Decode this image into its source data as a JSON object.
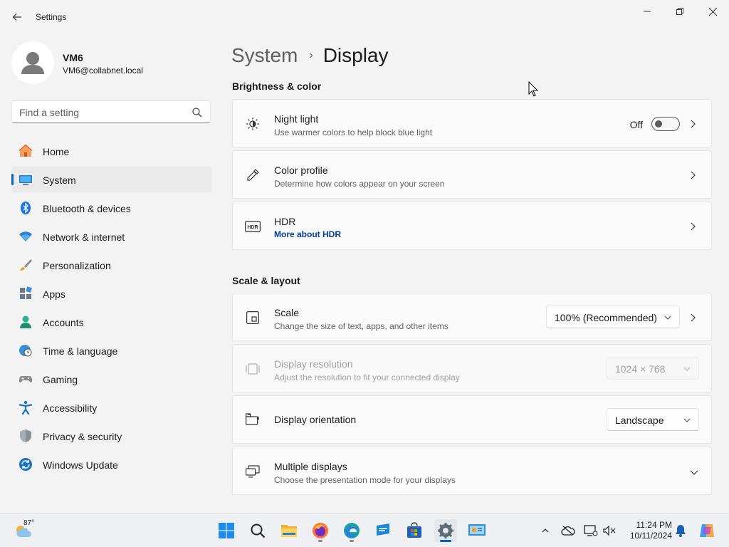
{
  "window": {
    "title": "Settings"
  },
  "profile": {
    "name": "VM6",
    "email": "VM6@collabnet.local"
  },
  "search": {
    "placeholder": "Find a setting"
  },
  "sidebar": {
    "items": [
      {
        "label": "Home",
        "icon": "home-icon"
      },
      {
        "label": "System",
        "icon": "system-icon",
        "active": true
      },
      {
        "label": "Bluetooth & devices",
        "icon": "bluetooth-icon"
      },
      {
        "label": "Network & internet",
        "icon": "network-icon"
      },
      {
        "label": "Personalization",
        "icon": "brush-icon"
      },
      {
        "label": "Apps",
        "icon": "apps-icon"
      },
      {
        "label": "Accounts",
        "icon": "accounts-icon"
      },
      {
        "label": "Time & language",
        "icon": "globe-clock-icon"
      },
      {
        "label": "Gaming",
        "icon": "gamepad-icon"
      },
      {
        "label": "Accessibility",
        "icon": "accessibility-icon"
      },
      {
        "label": "Privacy & security",
        "icon": "shield-icon"
      },
      {
        "label": "Windows Update",
        "icon": "update-icon"
      }
    ]
  },
  "breadcrumb": {
    "parent": "System",
    "separator": "›",
    "current": "Display"
  },
  "sections": {
    "brightness": "Brightness & color",
    "scale": "Scale & layout"
  },
  "cards": {
    "night_light": {
      "title": "Night light",
      "subtitle": "Use warmer colors to help block blue light",
      "toggle_text": "Off",
      "toggle_on": false
    },
    "color_profile": {
      "title": "Color profile",
      "subtitle": "Determine how colors appear on your screen"
    },
    "hdr": {
      "title": "HDR",
      "link": "More about HDR"
    },
    "scale": {
      "title": "Scale",
      "subtitle": "Change the size of text, apps, and other items",
      "value": "100% (Recommended)"
    },
    "resolution": {
      "title": "Display resolution",
      "subtitle": "Adjust the resolution to fit your connected display",
      "value": "1024 × 768",
      "disabled": true
    },
    "orientation": {
      "title": "Display orientation",
      "value": "Landscape"
    },
    "multiple": {
      "title": "Multiple displays",
      "subtitle": "Choose the presentation mode for your displays"
    }
  },
  "taskbar": {
    "weather_temp": "87°",
    "time": "11:24 PM",
    "date": "10/11/2024",
    "apps": [
      "start-icon",
      "search-icon",
      "file-explorer-icon",
      "firefox-icon",
      "edge-icon",
      "remote-app-icon",
      "store-icon",
      "settings-icon",
      "control-panel-icon"
    ]
  },
  "colors": {
    "accent": "#0067c0",
    "background": "#f3f3f3",
    "card": "#fbfbfb",
    "link": "#003e92"
  }
}
